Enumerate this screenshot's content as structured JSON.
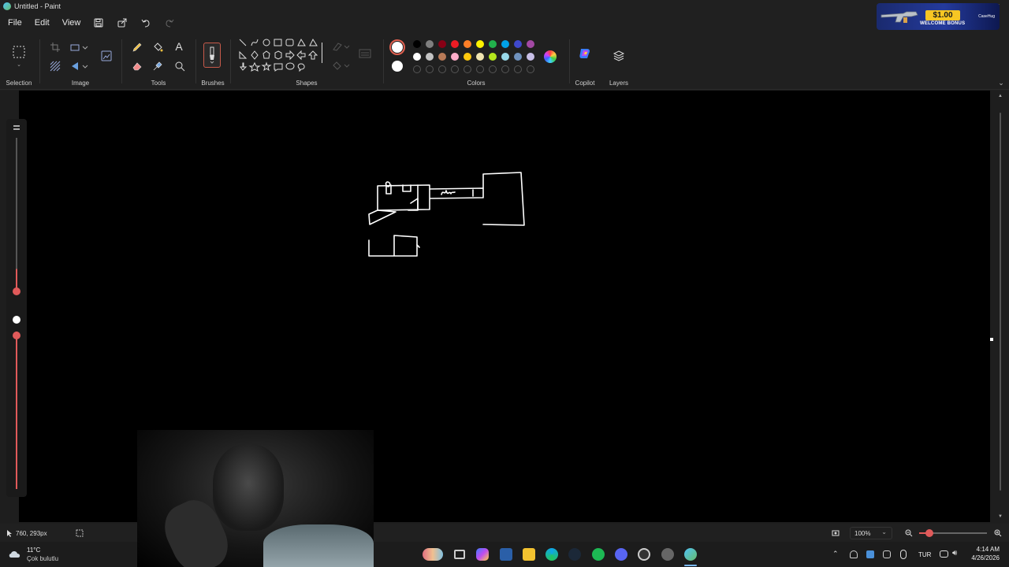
{
  "window": {
    "title": "Untitled - Paint",
    "controls": [
      "—",
      "□",
      "✕"
    ]
  },
  "promo": {
    "amount": "$1.00",
    "text": "WELCOME BONUS",
    "brand": "CaseHug"
  },
  "menu": {
    "file": "File",
    "edit": "Edit",
    "view": "View"
  },
  "ribbon": {
    "selection": "Selection",
    "image": "Image",
    "tools": "Tools",
    "brushes": "Brushes",
    "shapes": "Shapes",
    "colors": "Colors",
    "copilot": "Copilot",
    "layers": "Layers"
  },
  "palette": {
    "primary": "#ffffff",
    "row1": [
      "#000000",
      "#7f7f7f",
      "#880015",
      "#ed1c24",
      "#ff7f27",
      "#fff200",
      "#22b14c",
      "#00a2e8",
      "#3f48cc",
      "#a349a4"
    ],
    "row2": [
      "#ffffff",
      "#c3c3c3",
      "#b97a57",
      "#ffaec9",
      "#ffc90e",
      "#efe4b0",
      "#b5e61d",
      "#99d9ea",
      "#7092be",
      "#c8bfe7"
    ]
  },
  "status": {
    "position": "760, 293px",
    "zoom": "100%"
  },
  "taskbar": {
    "weather_temp": "11°C",
    "weather_desc": "Çok bulutlu",
    "language": "TUR",
    "time": "4:14 AM",
    "date": "4/26/2026"
  }
}
